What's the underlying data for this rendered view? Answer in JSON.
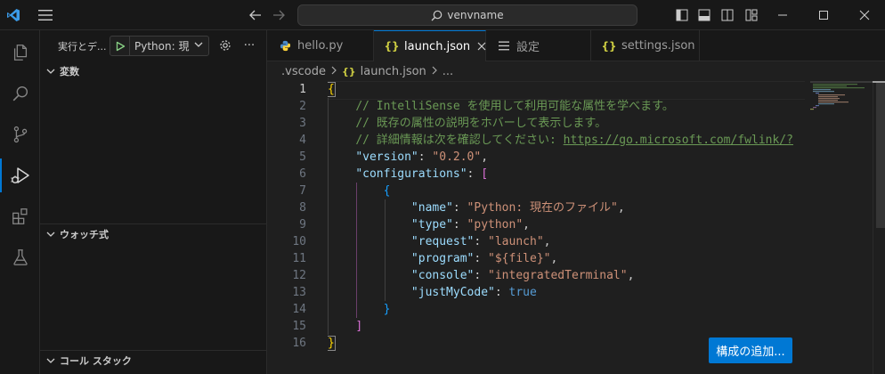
{
  "titlebar": {
    "search_text": "venvname"
  },
  "activitybar": {
    "items": [
      {
        "icon": "explorer-icon"
      },
      {
        "icon": "search-icon"
      },
      {
        "icon": "source-control-icon"
      },
      {
        "icon": "run-debug-icon",
        "active": true
      },
      {
        "icon": "extensions-icon"
      },
      {
        "icon": "testing-icon"
      }
    ]
  },
  "sidebar": {
    "title": "実行とデ...",
    "run_config": "Python: 現",
    "sections": {
      "variables": "変数",
      "watch": "ウォッチ式",
      "callstack": "コール スタック"
    }
  },
  "tabs": [
    {
      "label": "hello.py",
      "icon": "python-icon",
      "active": false
    },
    {
      "label": "launch.json",
      "icon": "json-icon",
      "active": true
    },
    {
      "label": "設定",
      "icon": "settings-list-icon",
      "active": false
    },
    {
      "label": "settings.json",
      "icon": "json-icon",
      "active": false
    }
  ],
  "breadcrumb": {
    "folder": ".vscode",
    "file": "launch.json",
    "more": "..."
  },
  "editor": {
    "line_numbers": [
      "1",
      "2",
      "3",
      "4",
      "5",
      "6",
      "7",
      "8",
      "9",
      "10",
      "11",
      "12",
      "13",
      "14",
      "15",
      "16"
    ],
    "current_line": 1,
    "lines": {
      "l1": "{",
      "l2": "// IntelliSense を使用して利用可能な属性を学べます。",
      "l3": "// 既存の属性の説明をホバーして表示します。",
      "l4_comment": "// 詳細情報は次を確認してください: ",
      "l4_link": "https://go.microsoft.com/fwlink/?",
      "version_key": "\"version\"",
      "version_val": "\"0.2.0\"",
      "configs_key": "\"configurations\"",
      "name_key": "\"name\"",
      "name_val": "\"Python: 現在のファイル\"",
      "type_key": "\"type\"",
      "type_val": "\"python\"",
      "request_key": "\"request\"",
      "request_val": "\"launch\"",
      "program_key": "\"program\"",
      "program_val": "\"${file}\"",
      "console_key": "\"console\"",
      "console_val": "\"integratedTerminal\"",
      "justmycode_key": "\"justMyCode\"",
      "justmycode_val": "true"
    }
  },
  "add_config_button": "構成の追加..."
}
